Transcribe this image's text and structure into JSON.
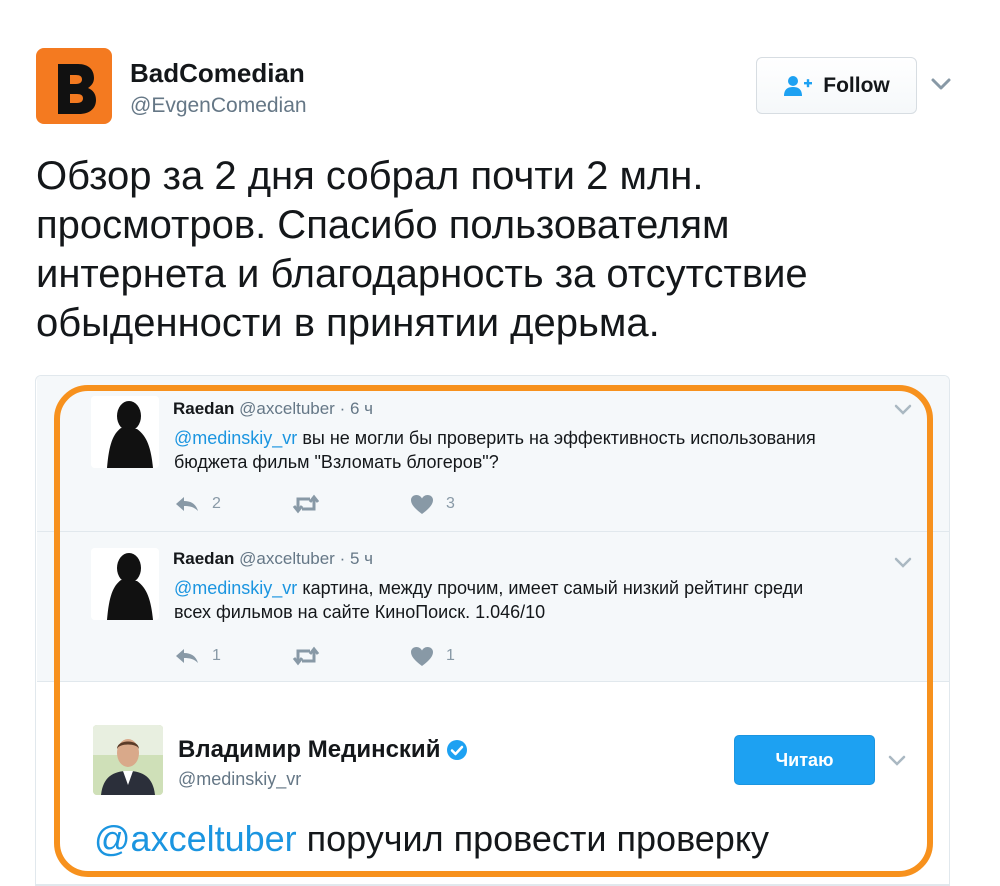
{
  "author": {
    "name": "BadComedian",
    "handle": "@EvgenComedian",
    "avatar_letter": "B",
    "avatar_color": "#f47a20"
  },
  "follow_button": {
    "label": "Follow",
    "icon": "add-user-icon"
  },
  "tweet": {
    "lines": [
      "Обзор за 2 дня собрал почти 2 млн.",
      "просмотров. Спасибо пользователям",
      "интернета и благодарность за отсутствие",
      "обыденности в принятии дерьма."
    ]
  },
  "embedded": {
    "replies": [
      {
        "name": "Raedan",
        "handle": "@axceltuber",
        "time": "· 6 ч",
        "mention": "@medinskiy_vr",
        "text_line1": " вы не могли бы проверить на эффективность использования",
        "text_line2": "бюджета фильм \"Взломать блогеров\"?",
        "replies_count": "2",
        "likes_count": "3"
      },
      {
        "name": "Raedan",
        "handle": "@axceltuber",
        "time": "· 5 ч",
        "mention": "@medinskiy_vr",
        "text_line1": " картина, между прочим, имеет самый низкий рейтинг среди",
        "text_line2": "всех фильмов на сайте КиноПоиск. 1.046/10",
        "replies_count": "1",
        "likes_count": "1"
      }
    ],
    "main": {
      "name": "Владимир Мединский",
      "verified_icon": "verified-badge-icon",
      "handle": "@medinskiy_vr",
      "button_label": "Читаю",
      "mention": "@axceltuber",
      "text": " поручил провести проверку"
    }
  },
  "colors": {
    "link": "#1b95e0",
    "button_blue": "#1da1f2",
    "highlight": "#f7911d",
    "muted": "#657786"
  }
}
